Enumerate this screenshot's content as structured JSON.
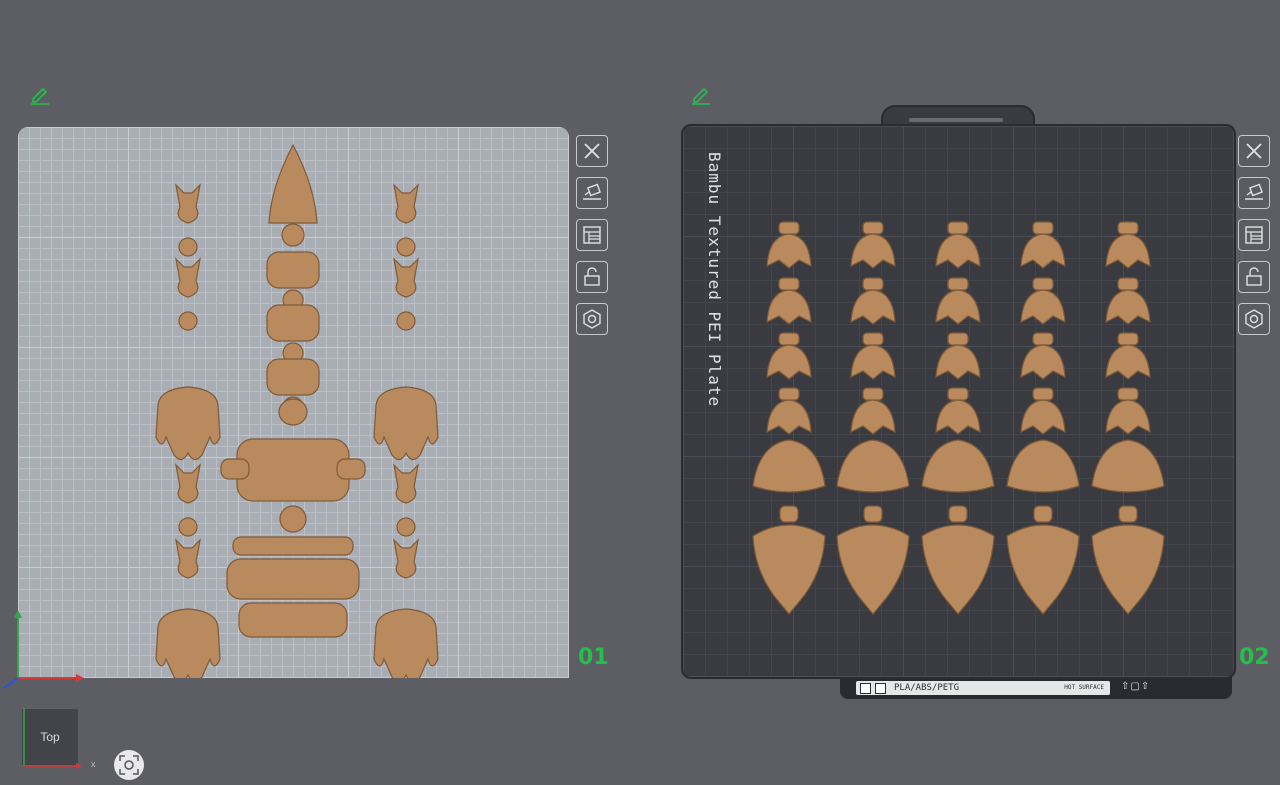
{
  "plates": [
    {
      "number": "01"
    },
    {
      "number": "02",
      "label": "Bambu Textured PEI Plate",
      "strip": {
        "material": "PLA/ABS/PETG",
        "hot_surface": "HOT SURFACE"
      }
    }
  ],
  "toolbar": {
    "icons": [
      "close-icon",
      "auto-orient-icon",
      "arrange-icon",
      "lock-icon",
      "settings-icon"
    ]
  },
  "view_cube": {
    "label": "Top"
  },
  "axis": {
    "x_label": "x"
  },
  "colors": {
    "plate1_bg": "#a9adb4",
    "plate2_bg": "#3a3b41",
    "part": "#b98a5e",
    "accent": "#23c04a",
    "background": "#5d5e63"
  }
}
